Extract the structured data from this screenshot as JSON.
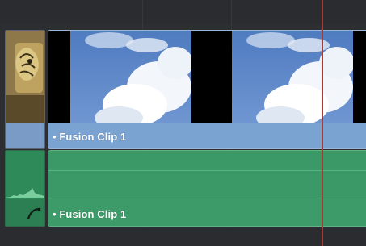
{
  "timeline": {
    "video_track": {
      "clip": {
        "label": "• Fusion Clip 1",
        "color": "#7ba3d2"
      }
    },
    "audio_track": {
      "clip": {
        "label": "• Fusion Clip 1",
        "color": "#3a9966"
      }
    },
    "playhead": {
      "color": "#a83a34"
    }
  }
}
